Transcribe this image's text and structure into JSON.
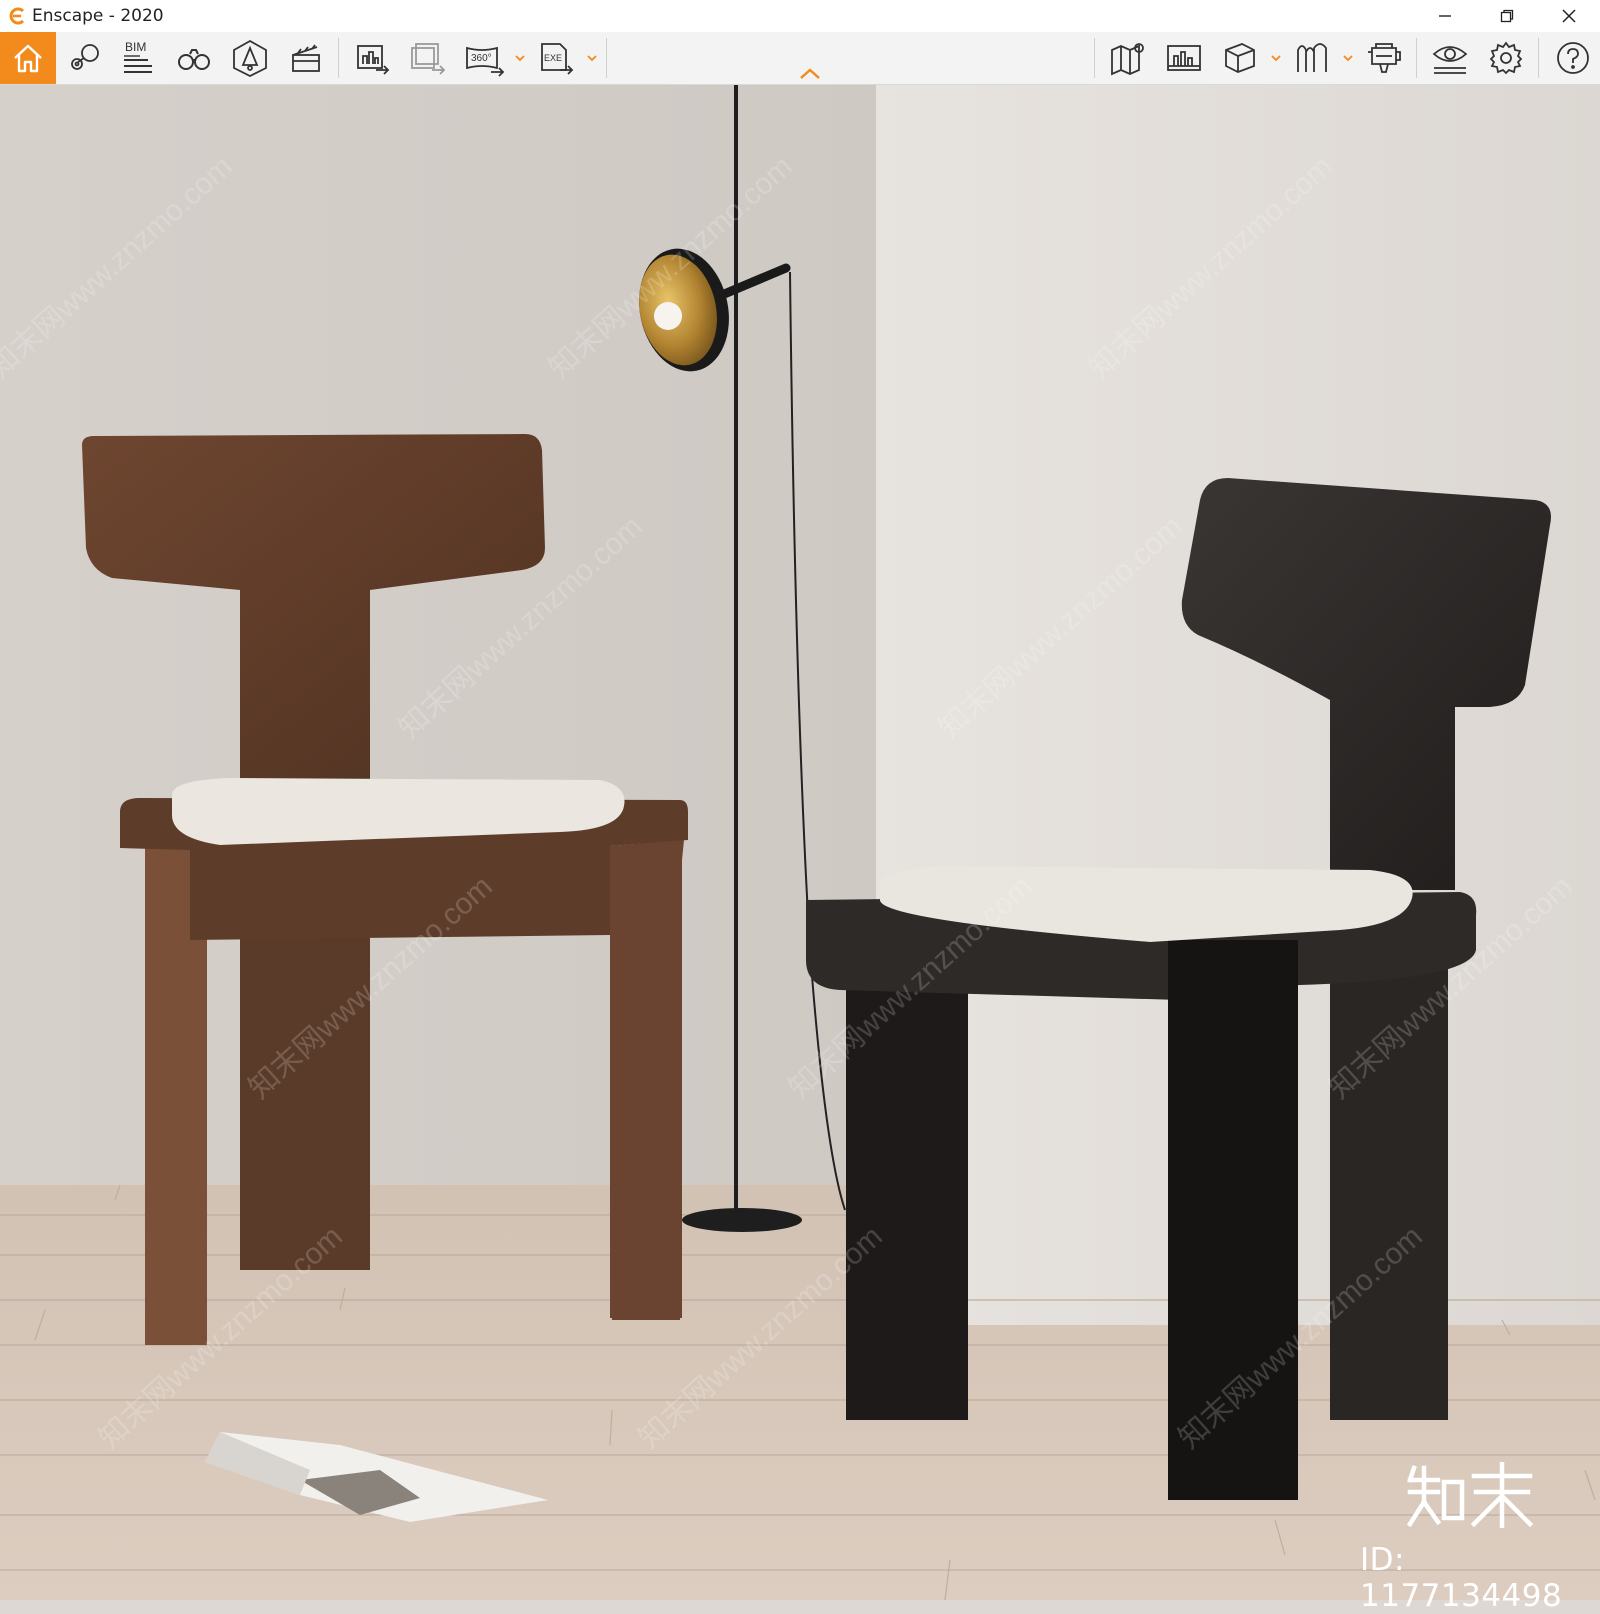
{
  "window": {
    "title": "Enscape - 2020"
  },
  "toolbar": {
    "bim_label": "BIM",
    "panorama_label": "360°",
    "exe_label": "EXE",
    "accent": "#f28a1c",
    "left_icons": [
      "home-icon",
      "pin-marker-icon",
      "bim-list-icon",
      "binoculars-icon",
      "sun-house-icon",
      "clapperboard-icon",
      "screenshot-export-icon",
      "batch-render-icon",
      "panorama-360-icon",
      "exe-export-icon"
    ],
    "right_icons": [
      "map-icon",
      "asset-library-icon",
      "cube-view-icon",
      "visual-mode-icon",
      "vr-headset-icon",
      "eye-settings-icon",
      "gear-icon",
      "help-icon"
    ]
  },
  "watermark": {
    "logo_text": "知末",
    "id_text": "ID: 1177134498"
  }
}
